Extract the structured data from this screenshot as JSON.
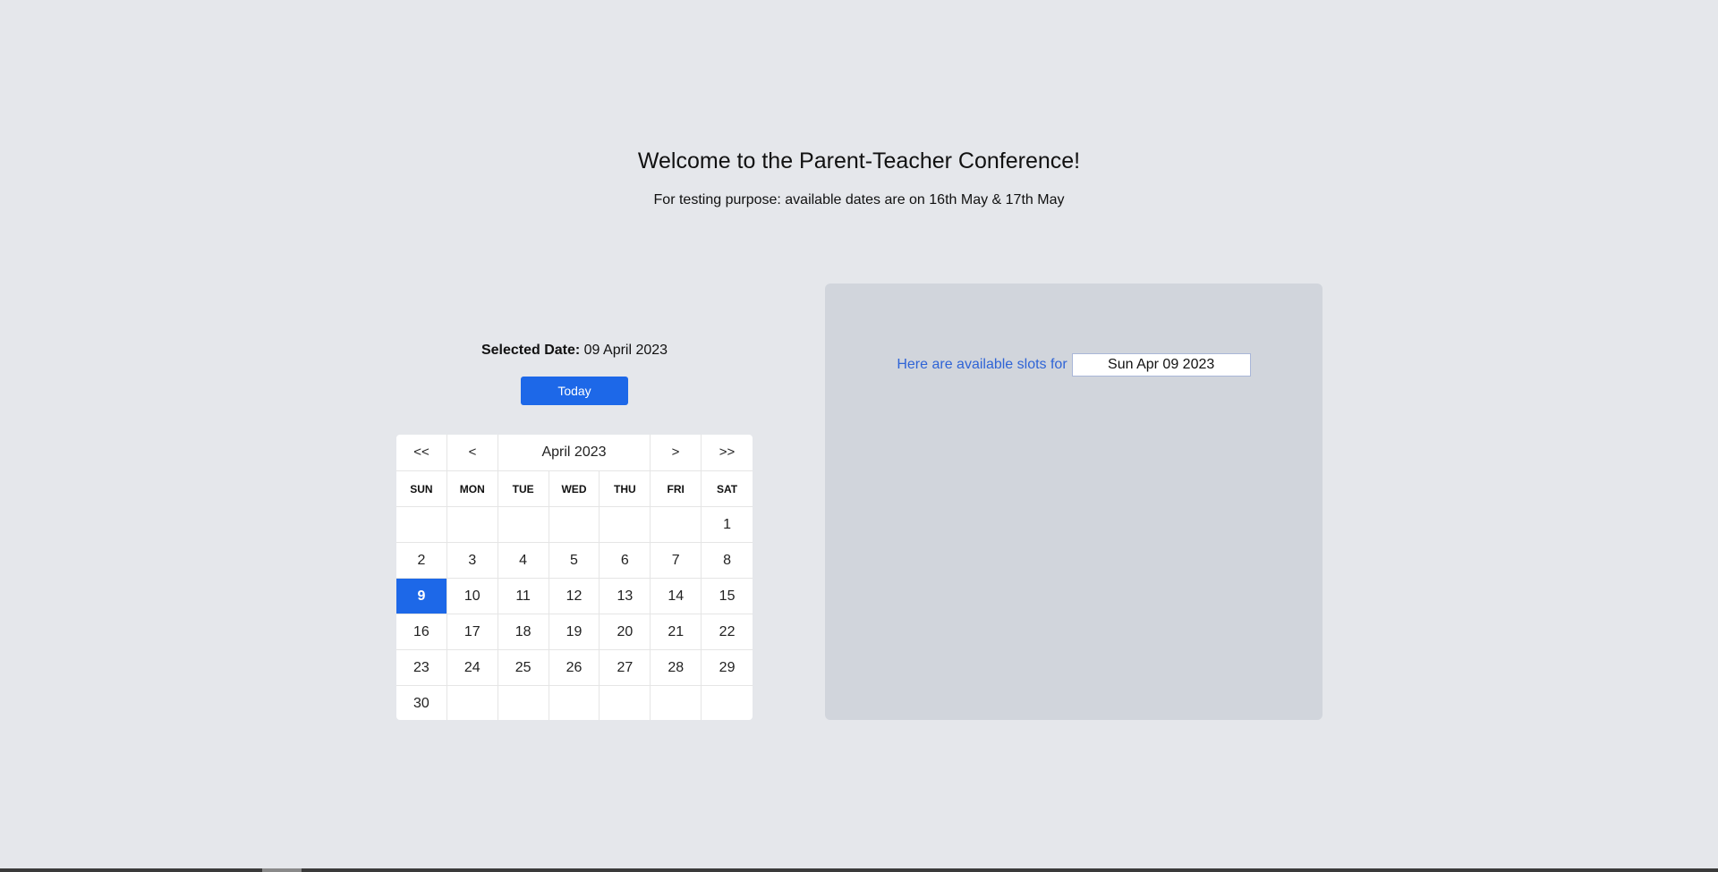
{
  "header": {
    "title": "Welcome to the Parent-Teacher Conference!",
    "subtitle": "For testing purpose: available dates are on 16th May & 17th May"
  },
  "selection": {
    "label": "Selected Date:",
    "value": "09 April 2023"
  },
  "today_button": {
    "label": "Today"
  },
  "calendar": {
    "nav": {
      "prev_year": "<<",
      "prev_month": "<",
      "month_label": "April 2023",
      "next_month": ">",
      "next_year": ">>"
    },
    "weekdays": [
      "SUN",
      "MON",
      "TUE",
      "WED",
      "THU",
      "FRI",
      "SAT"
    ],
    "weeks": [
      [
        "",
        "",
        "",
        "",
        "",
        "",
        "1"
      ],
      [
        "2",
        "3",
        "4",
        "5",
        "6",
        "7",
        "8"
      ],
      [
        "9",
        "10",
        "11",
        "12",
        "13",
        "14",
        "15"
      ],
      [
        "16",
        "17",
        "18",
        "19",
        "20",
        "21",
        "22"
      ],
      [
        "23",
        "24",
        "25",
        "26",
        "27",
        "28",
        "29"
      ],
      [
        "30",
        "",
        "",
        "",
        "",
        "",
        ""
      ]
    ],
    "selected_day": "9"
  },
  "slots": {
    "label": "Here are available slots for",
    "date_value": "Sun Apr 09 2023"
  },
  "colors": {
    "accent": "#1d68e8",
    "background": "#e5e7eb",
    "panel": "#d1d5dc",
    "slots_label": "#2f64d6"
  }
}
